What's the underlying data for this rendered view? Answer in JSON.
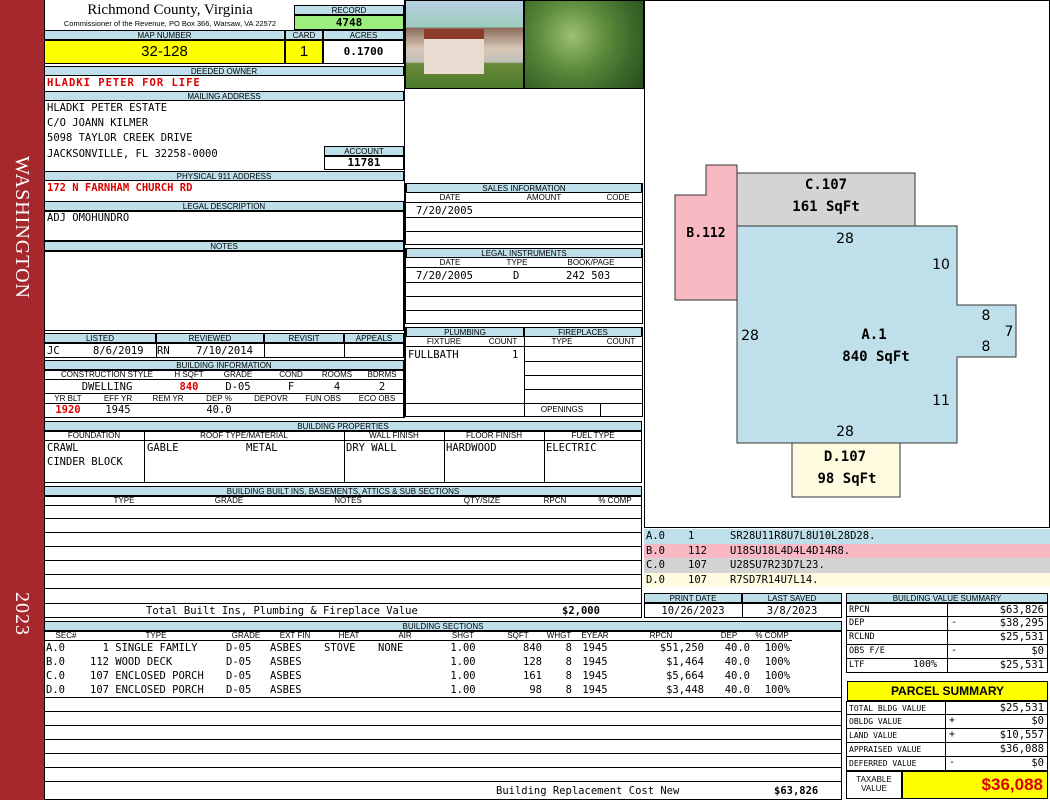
{
  "sidebar": {
    "district": "WASHINGTON",
    "year": "2023"
  },
  "header": {
    "county": "Richmond County, Virginia",
    "commissioner": "Commissioner of the Revenue, PO Box 366, Warsaw, VA 22572",
    "record_label": "RECORD",
    "record": "4748",
    "map_number_label": "MAP NUMBER",
    "map_number": "32-128",
    "card_label": "CARD",
    "card": "1",
    "acres_label": "ACRES",
    "acres": "0.1700"
  },
  "owner": {
    "deeded_owner_label": "DEEDED OWNER",
    "deeded_owner": "HLADKI PETER FOR LIFE",
    "mailing_address_label": "MAILING ADDRESS",
    "mailing": [
      "HLADKI PETER ESTATE",
      "C/O JOANN KILMER",
      "5098 TAYLOR CREEK DRIVE",
      "JACKSONVILLE, FL 32258-0000"
    ],
    "account_label": "ACCOUNT",
    "account": "11781",
    "physical_label": "PHYSICAL 911 ADDRESS",
    "physical": "172 N FARNHAM CHURCH RD",
    "legal_label": "LEGAL DESCRIPTION",
    "legal": "ADJ OMOHUNDRO",
    "notes_label": "NOTES"
  },
  "sales": {
    "title": "SALES INFORMATION",
    "col_date": "DATE",
    "col_amount": "AMOUNT",
    "col_code": "CODE",
    "rows": [
      {
        "date": "7/20/2005",
        "amount": "",
        "code": ""
      }
    ]
  },
  "legal_instruments": {
    "title": "LEGAL INSTRUMENTS",
    "col_date": "DATE",
    "col_type": "TYPE",
    "col_book": "BOOK/PAGE",
    "rows": [
      {
        "date": "7/20/2005",
        "type": "D",
        "book": "242 503"
      }
    ]
  },
  "review": {
    "listed_label": "LISTED",
    "reviewed_label": "REVIEWED",
    "revisit_label": "REVISIT",
    "appeals_label": "APPEALS",
    "listed_by": "JC",
    "listed_date": "8/6/2019",
    "reviewed_by": "RN",
    "reviewed_date": "7/10/2014"
  },
  "building_info": {
    "title": "BUILDING INFORMATION",
    "labels": {
      "style": "CONSTRUCTION STYLE",
      "hsqft": "H SQFT",
      "grade": "GRADE",
      "cond": "COND",
      "rooms": "ROOMS",
      "bdrms": "BDRMS",
      "yrblt": "YR BLT",
      "effyr": "EFF YR",
      "remyr": "REM YR",
      "dep": "DEP %",
      "depovr": "DEPOVR",
      "funobs": "FUN OBS",
      "ecoobs": "ECO OBS"
    },
    "style": "DWELLING",
    "hsqft": "840",
    "grade": "D-05",
    "cond": "F",
    "rooms": "4",
    "bdrms": "2",
    "yrblt": "1920",
    "effyr": "1945",
    "remyr": "",
    "dep": "40.0"
  },
  "plumbing": {
    "title": "PLUMBING",
    "col_fixture": "FIXTURE",
    "col_count": "COUNT",
    "rows": [
      {
        "fixture": "FULLBATH",
        "count": "1"
      }
    ]
  },
  "fireplaces": {
    "title": "FIREPLACES",
    "col_type": "TYPE",
    "col_count": "COUNT",
    "openings_label": "OPENINGS"
  },
  "properties": {
    "title": "BUILDING PROPERTIES",
    "foundation_label": "FOUNDATION",
    "roof_label": "ROOF TYPE/MATERIAL",
    "wall_label": "WALL FINISH",
    "floor_label": "FLOOR FINISH",
    "fuel_label": "FUEL TYPE",
    "foundation": [
      "CRAWL",
      "CINDER BLOCK"
    ],
    "roof_type": "GABLE",
    "roof_material": "METAL",
    "wall": "DRY WALL",
    "floor": "HARDWOOD",
    "fuel": "ELECTRIC"
  },
  "builtins": {
    "title": "BUILDING BUILT INS, BASEMENTS, ATTICS & SUB SECTIONS",
    "cols": [
      "TYPE",
      "GRADE",
      "NOTES",
      "QTY/SIZE",
      "RPCN",
      "% COMP"
    ],
    "total_label": "Total Built Ins, Plumbing & Fireplace Value",
    "total": "$2,000"
  },
  "print_info": {
    "print_label": "PRINT DATE",
    "saved_label": "LAST SAVED",
    "print_date": "10/26/2023",
    "last_saved": "3/8/2023"
  },
  "sections": {
    "title": "BUILDING SECTIONS",
    "cols": [
      "SEC#",
      "TYPE",
      "GRADE",
      "EXT FIN",
      "HEAT",
      "AIR",
      "SHGT",
      "SQFT",
      "WHGT",
      "EYEAR",
      "RPCN",
      "DEP",
      "% COMP"
    ],
    "rows": [
      {
        "sec": "A.0",
        "type": "  1 SINGLE FAMILY",
        "grade": "D-05",
        "ext": "ASBES",
        "heat": "STOVE",
        "air": "NONE",
        "shgt": "1.00",
        "sqft": "840",
        "whgt": "8",
        "eyear": "1945",
        "rpcn": "$51,250",
        "dep": "40.0",
        "comp": "100%"
      },
      {
        "sec": "B.0",
        "type": "112 WOOD DECK",
        "grade": "D-05",
        "ext": "ASBES",
        "heat": "",
        "air": "",
        "shgt": "1.00",
        "sqft": "128",
        "whgt": "8",
        "eyear": "1945",
        "rpcn": "$1,464",
        "dep": "40.0",
        "comp": "100%"
      },
      {
        "sec": "C.0",
        "type": "107 ENCLOSED PORCH",
        "grade": "D-05",
        "ext": "ASBES",
        "heat": "",
        "air": "",
        "shgt": "1.00",
        "sqft": "161",
        "whgt": "8",
        "eyear": "1945",
        "rpcn": "$5,664",
        "dep": "40.0",
        "comp": "100%"
      },
      {
        "sec": "D.0",
        "type": "107 ENCLOSED PORCH",
        "grade": "D-05",
        "ext": "ASBES",
        "heat": "",
        "air": "",
        "shgt": "1.00",
        "sqft": "98",
        "whgt": "8",
        "eyear": "1945",
        "rpcn": "$3,448",
        "dep": "40.0",
        "comp": "100%"
      }
    ],
    "replacement_label": "Building Replacement Cost New",
    "replacement": "$63,826"
  },
  "sketch": {
    "labels": {
      "c_name": "C.107",
      "c_area": "161 SqFt",
      "b_name": "B.112",
      "a_name": "A.1",
      "a_area": "840 SqFt",
      "d_name": "D.107",
      "d_area": "98 SqFt",
      "dims": [
        "28",
        "10",
        "8",
        "7",
        "8",
        "28",
        "11",
        "28"
      ]
    },
    "colors": {
      "a": "#bfe0ea",
      "b": "#f8b8c4",
      "c": "#d4d4d4",
      "d": "#fffbe0"
    },
    "vectors": [
      {
        "sec": "A.0",
        "code": "1",
        "vec": "SR28U11R8U7L8U10L28D28."
      },
      {
        "sec": "B.0",
        "code": "112",
        "vec": "U18SU18L4D4L4D14R8."
      },
      {
        "sec": "C.0",
        "code": "107",
        "vec": "U28SU7R23D7L23."
      },
      {
        "sec": "D.0",
        "code": "107",
        "vec": "R7SD7R14U7L14."
      }
    ]
  },
  "value_summary": {
    "title": "BUILDING VALUE SUMMARY",
    "rows": [
      {
        "label": "RPCN",
        "sign": "",
        "pct": "",
        "value": "$63,826"
      },
      {
        "label": "DEP",
        "sign": "-",
        "pct": "",
        "value": "$38,295"
      },
      {
        "label": "RCLND",
        "sign": "",
        "pct": "",
        "value": "$25,531"
      },
      {
        "label": "OBS F/E",
        "sign": "-",
        "pct": "",
        "value": "$0"
      },
      {
        "label": "LTF",
        "sign": "",
        "pct": "100%",
        "value": "$25,531"
      }
    ]
  },
  "parcel_summary": {
    "title": "PARCEL SUMMARY",
    "rows": [
      {
        "label": "TOTAL BLDG VALUE",
        "sign": "",
        "value": "$25,531"
      },
      {
        "label": "OBLDG VALUE",
        "sign": "+",
        "value": "$0"
      },
      {
        "label": "LAND VALUE",
        "sign": "+",
        "value": "$10,557"
      },
      {
        "label": "APPRAISED VALUE",
        "sign": "",
        "value": "$36,088"
      },
      {
        "label": "DEFERRED VALUE",
        "sign": "-",
        "value": "$0"
      }
    ],
    "taxable_label": "TAXABLE VALUE",
    "taxable": "$36,088"
  }
}
